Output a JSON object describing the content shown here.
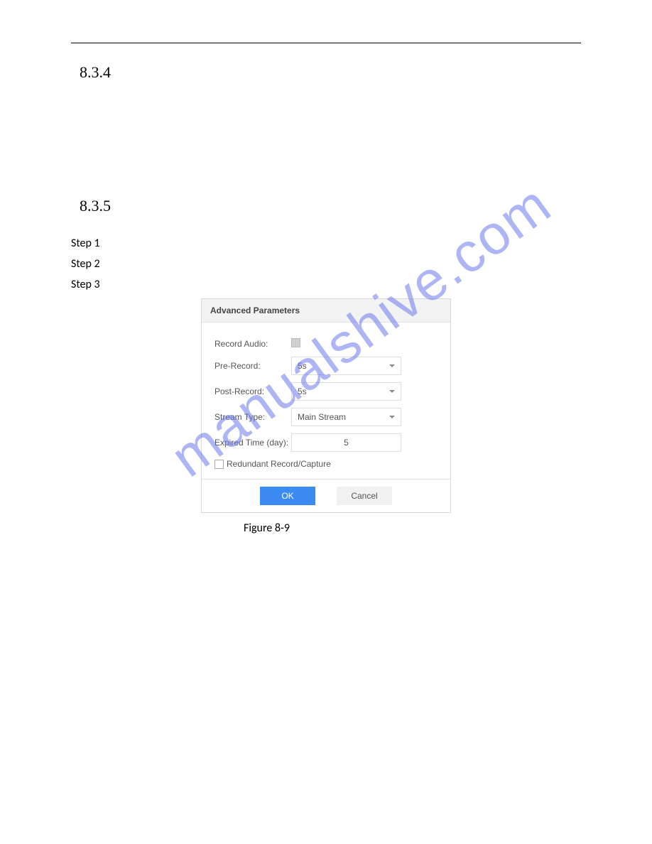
{
  "sections": {
    "sec834": "8.3.4",
    "sec835": "8.3.5"
  },
  "steps": {
    "s1": "Step 1",
    "s2": "Step 2",
    "s3": "Step 3"
  },
  "dialog": {
    "title": "Advanced Parameters",
    "record_audio_label": "Record Audio:",
    "pre_record_label": "Pre-Record:",
    "pre_record_value": "5s",
    "post_record_label": "Post-Record:",
    "post_record_value": "5s",
    "stream_type_label": "Stream Type:",
    "stream_type_value": "Main Stream",
    "expired_label": "Expired Time (day):",
    "expired_value": "5",
    "redundant_label": "Redundant Record/Capture",
    "ok": "OK",
    "cancel": "Cancel"
  },
  "figure_caption": "Figure 8-9",
  "watermark": "manualshive.com"
}
